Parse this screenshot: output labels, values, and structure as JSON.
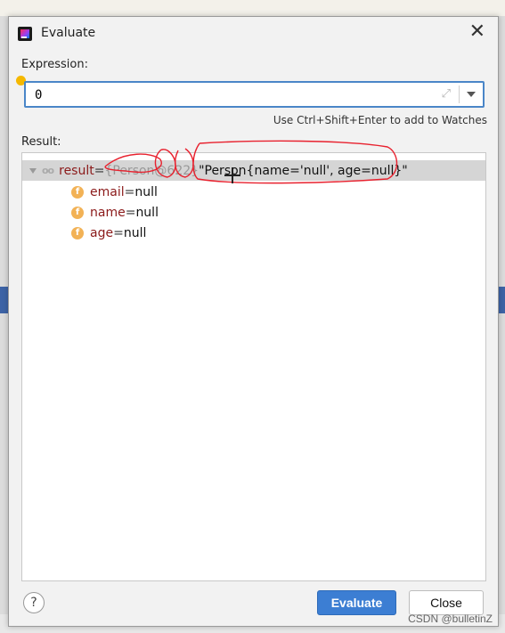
{
  "dialog": {
    "title": "Evaluate",
    "close_glyph": "✕"
  },
  "expression": {
    "label": "Expression:",
    "value": "0",
    "expand_glyph": "⤢",
    "hint": "Use Ctrl+Shift+Enter to add to Watches"
  },
  "result": {
    "label": "Result:",
    "root": {
      "icon_text": "oo",
      "name": "result",
      "eq": " = ",
      "ref": "{Person@622}",
      "value": " \"Person{name='null', age=null}\""
    },
    "fields": [
      {
        "icon": "f",
        "name": "email",
        "eq": " = ",
        "value": "null"
      },
      {
        "icon": "f",
        "name": "name",
        "eq": " = ",
        "value": "null"
      },
      {
        "icon": "f",
        "name": "age",
        "eq": " = ",
        "value": "null"
      }
    ]
  },
  "footer": {
    "help_label": "?",
    "evaluate_label": "Evaluate",
    "close_label": "Close"
  },
  "watermark": "CSDN @bulletinZ",
  "colors": {
    "accent": "#3c7ed3",
    "annotation": "#e8212e",
    "field_icon": "#f2b256"
  }
}
